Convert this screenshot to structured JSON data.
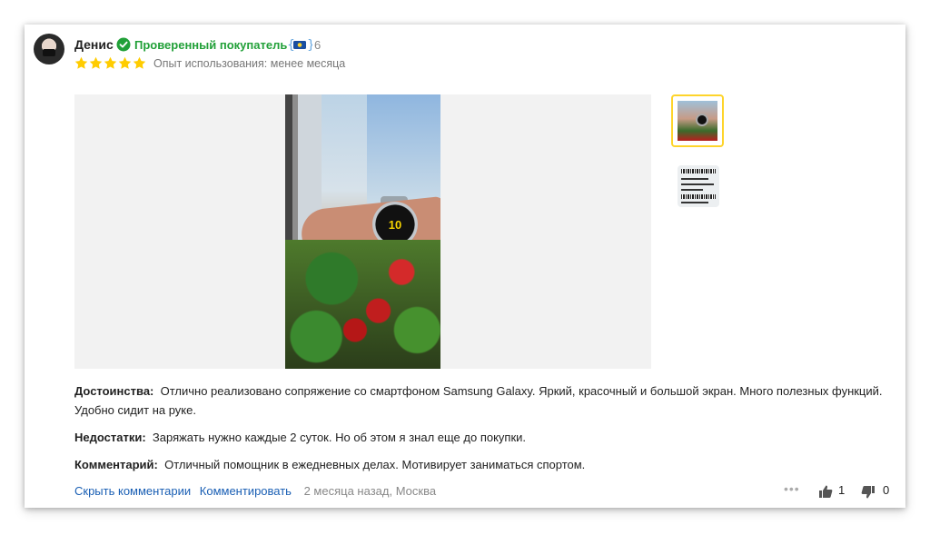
{
  "review": {
    "author": {
      "name": "Денис",
      "verified_label": "Проверенный покупатель",
      "badge_count": "6"
    },
    "rating": 5,
    "usage": "Опыт использования: менее месяца",
    "pros": {
      "label": "Достоинства:",
      "text": "Отлично реализовано сопряжение со смартфоном Samsung Galaxy. Яркий, красочный и большой экран. Много полезных функций. Удобно сидит на руке."
    },
    "cons": {
      "label": "Недостатки:",
      "text": "Заряжать нужно каждые 2 суток. Но об этом я знал еще до покупки."
    },
    "comment": {
      "label": "Комментарий:",
      "text": "Отличный помощник в ежедневных делах. Мотивирует заниматься спортом."
    },
    "photo": {
      "watch_display": "10"
    },
    "footer": {
      "hide_comments": "Скрыть комментарии",
      "add_comment": "Комментировать",
      "meta": "2 месяца назад, Москва",
      "likes": "1",
      "dislikes": "0"
    }
  },
  "colors": {
    "verified": "#21a038",
    "star": "#fc0",
    "link": "#1a5fb4",
    "thumb_selected": "#fed42b"
  },
  "icons": [
    "verified-check-icon",
    "badge-icon",
    "star-icon",
    "more-icon",
    "thumbs-up-icon",
    "thumbs-down-icon"
  ]
}
